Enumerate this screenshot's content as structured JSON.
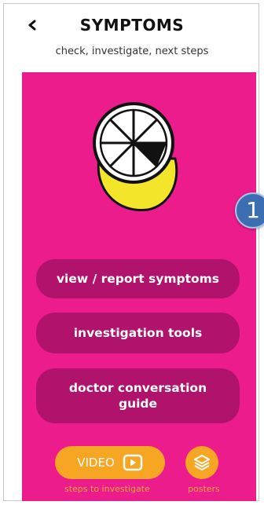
{
  "header": {
    "title": "SYMPTOMS",
    "subtitle": "check, investigate, next steps",
    "back_icon": "back-chevron-icon"
  },
  "step_badge": {
    "label": "1",
    "color": "#3b6fb2"
  },
  "hero": {
    "icon": "lemon-slice-icon"
  },
  "menu": {
    "items": [
      {
        "label": "view / report symptoms"
      },
      {
        "label": "investigation tools"
      },
      {
        "label": "doctor conversation guide"
      }
    ]
  },
  "footer": {
    "video_label": "VIDEO",
    "video_caption": "steps to investigate",
    "posters_caption": "posters",
    "video_icon": "play-icon",
    "posters_icon": "layers-icon"
  },
  "colors": {
    "panel": "#ec1c8d",
    "button": "#b1126b",
    "accent": "#f6a623",
    "lemon": "#f3e52a"
  }
}
